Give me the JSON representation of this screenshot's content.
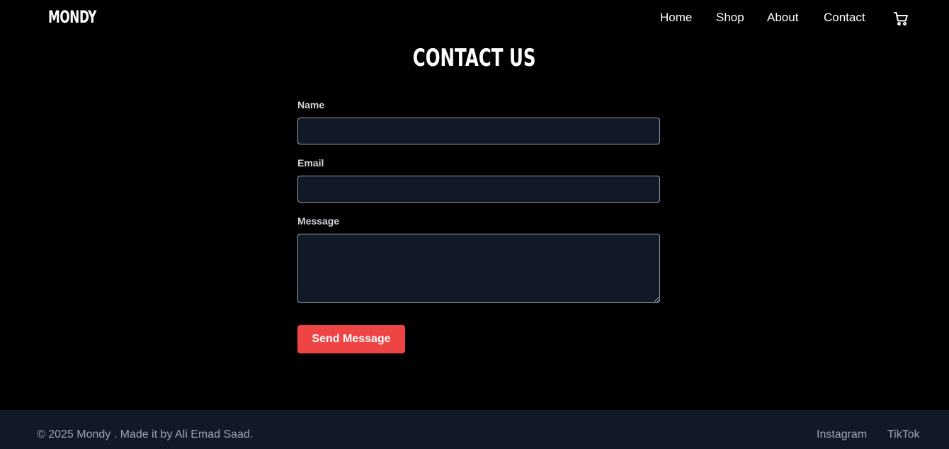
{
  "brand": {
    "logo": "MONDY"
  },
  "nav": {
    "home": "Home",
    "shop": "Shop",
    "about": "About",
    "contact": "Contact",
    "cart_icon": "shopping-cart-icon"
  },
  "main": {
    "title": "CONTACT US",
    "form": {
      "name_label": "Name",
      "name_value": "",
      "email_label": "Email",
      "email_value": "",
      "message_label": "Message",
      "message_value": "",
      "submit_label": "Send Message"
    }
  },
  "footer": {
    "copyright": "© 2025 Mondy . Made it by Ali Emad Saad.",
    "instagram": "Instagram",
    "tiktok": "TikTok"
  },
  "colors": {
    "background": "#000000",
    "accent": "#ef4444",
    "field_bg": "#111827",
    "footer_bg": "#111827",
    "muted_text": "#9ca3af"
  }
}
